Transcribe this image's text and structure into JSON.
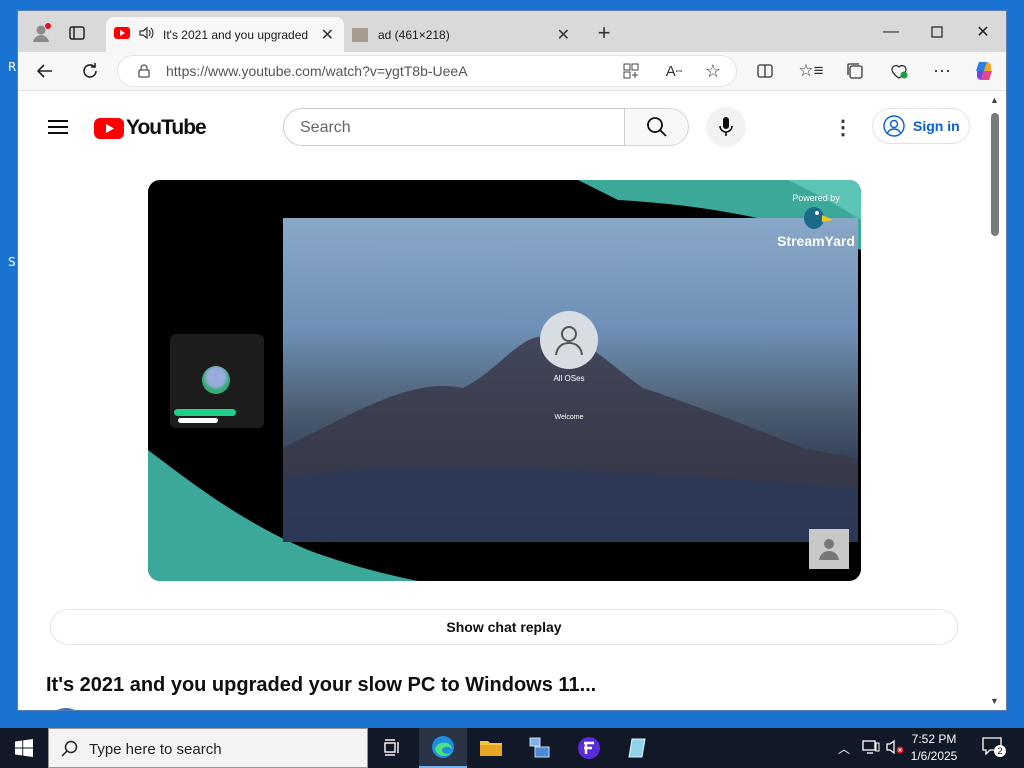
{
  "browser": {
    "tabs": [
      {
        "title": "It's 2021 and you upgraded your slow PC to Windows 11...",
        "active": true,
        "icon": "youtube-icon",
        "audio": true
      },
      {
        "title": "ad (461×218)",
        "active": false,
        "icon": "image-icon"
      }
    ],
    "url": "https://www.youtube.com/watch?v=ygtT8b-UeeA"
  },
  "youtube": {
    "logo_text": "YouTube",
    "search_placeholder": "Search",
    "sign_in": "Sign in",
    "video": {
      "watermark_powered": "Powered by",
      "watermark_brand": "StreamYard",
      "lock_screen_user": "All OSes",
      "lock_screen_status": "Welcome"
    },
    "show_chat_replay": "Show chat replay",
    "video_title": "It's 2021 and you upgraded your slow PC to Windows 11..."
  },
  "taskbar": {
    "search_placeholder": "Type here to search",
    "time": "7:52 PM",
    "date": "1/6/2025",
    "notifications": "2"
  },
  "colors": {
    "youtube_red": "#ff0000",
    "link_blue": "#065fd4",
    "desktop_blue": "#1a73d1",
    "taskbar": "#111827"
  }
}
